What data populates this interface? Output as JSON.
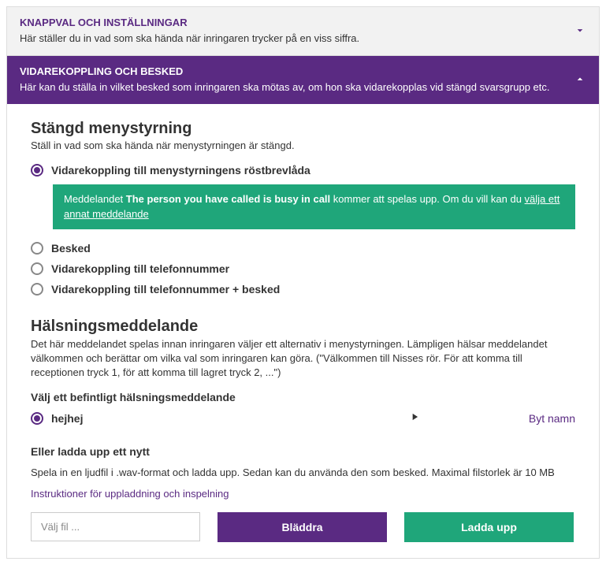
{
  "panels": {
    "knappval": {
      "title": "KNAPPVAL OCH INSTÄLLNINGAR",
      "sub": "Här ställer du in vad som ska hända när inringaren trycker på en viss siffra."
    },
    "vidare": {
      "title": "VIDAREKOPPLING OCH BESKED",
      "sub": "Här kan du ställa in vilket besked som inringaren ska mötas av, om hon ska vidarekopplas vid stängd svarsgrupp etc."
    }
  },
  "closed": {
    "title": "Stängd menystyrning",
    "sub": "Ställ in vad som ska hända när menystyrningen är stängd.",
    "options": {
      "o1": "Vidarekoppling till menystyrningens röstbrevlåda",
      "o2": "Besked",
      "o3": "Vidarekoppling till telefonnummer",
      "o4": "Vidarekoppling till telefonnummer + besked"
    },
    "banner": {
      "prefix": "Meddelandet ",
      "bold": "The person you have called is busy in call",
      "mid": " kommer att spelas upp. Om du vill kan du ",
      "link": "välja ett annat meddelande"
    }
  },
  "greeting": {
    "title": "Hälsningsmeddelande",
    "text": "Det här meddelandet spelas innan inringaren väljer ett alternativ i menystyrningen. Lämpligen hälsar meddelandet välkommen och berättar om vilka val som inringaren kan göra. (\"Välkommen till Nisses rör. För att komma till receptionen tryck 1, för att komma till lagret tryck 2, ...\")",
    "choose_label": "Välj ett befintligt hälsningsmeddelande",
    "selected": "hejhej",
    "rename": "Byt namn"
  },
  "upload": {
    "heading": "Eller ladda upp ett nytt",
    "text": "Spela in en ljudfil i .wav-format och ladda upp. Sedan kan du använda den som besked. Maximal filstorlek är 10 MB",
    "instr_link": "Instruktioner för uppladdning och inspelning",
    "placeholder": "Välj fil ...",
    "browse": "Bläddra",
    "upload": "Ladda upp"
  }
}
